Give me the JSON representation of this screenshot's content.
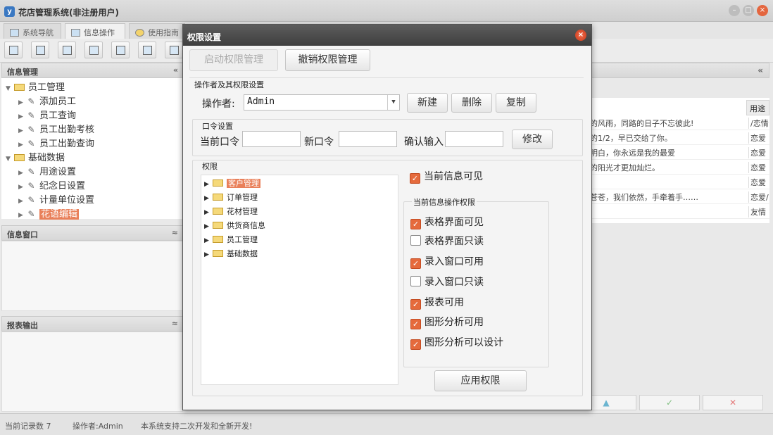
{
  "app": {
    "title": "花店管理系统(非注册用户)",
    "icon_glyph": "y"
  },
  "tabs": [
    {
      "label": "系统导航"
    },
    {
      "label": "信息操作"
    },
    {
      "label": "使用指南"
    }
  ],
  "left": {
    "panel1_title": "信息管理",
    "tree": [
      {
        "label": "员工管理",
        "type": "folder",
        "expanded": true
      },
      {
        "label": "添加员工",
        "type": "leaf"
      },
      {
        "label": "员工查询",
        "type": "leaf"
      },
      {
        "label": "员工出勤考核",
        "type": "leaf"
      },
      {
        "label": "员工出勤查询",
        "type": "leaf"
      },
      {
        "label": "基础数据",
        "type": "folder",
        "expanded": true
      },
      {
        "label": "用途设置",
        "type": "leaf"
      },
      {
        "label": "纪念日设置",
        "type": "leaf"
      },
      {
        "label": "计量单位设置",
        "type": "leaf"
      },
      {
        "label": "花语编辑",
        "type": "leaf",
        "selected": true
      }
    ],
    "panel2_title": "信息窗口",
    "panel3_title": "报表输出"
  },
  "right": {
    "column_header": "用途",
    "rows": [
      {
        "text": "的风雨，同路的日子不忘彼此!",
        "use": "/恋情"
      },
      {
        "text": "的1/2，早已交给了你。",
        "use": "恋爱"
      },
      {
        "text": "明白，你永远是我的最爱",
        "use": "恋爱"
      },
      {
        "text": "的阳光才更加灿烂。",
        "use": "恋爱"
      },
      {
        "text": "",
        "use": "恋爱"
      },
      {
        "text": "苍苍，我们依然，手牵着手……",
        "use": "恋爱/"
      },
      {
        "text": "",
        "use": "友情"
      }
    ],
    "nav_icons": [
      "up-icon",
      "check-icon",
      "cross-icon"
    ]
  },
  "status": {
    "record_count": "当前记录数 7",
    "operator": "操作者:Admin",
    "message": "本系统支持二次开发和全新开发!"
  },
  "dialog": {
    "title": "权限设置",
    "enable_btn": "启动权限管理",
    "revoke_btn": "撤销权限管理",
    "operator_group": "操作者及其权限设置",
    "operator_label": "操作者:",
    "operator_value": "Admin",
    "new_btn": "新建",
    "delete_btn": "删除",
    "copy_btn": "复制",
    "password_group": "口令设置",
    "current_pw_label": "当前口令",
    "new_pw_label": "新口令",
    "confirm_label": "确认输入",
    "modify_btn": "修改",
    "perm_group": "权限",
    "perm_tree": [
      {
        "label": "客户管理",
        "selected": true
      },
      {
        "label": "订单管理"
      },
      {
        "label": "花材管理"
      },
      {
        "label": "供货商信息"
      },
      {
        "label": "员工管理"
      },
      {
        "label": "基础数据"
      }
    ],
    "current_visible": {
      "label": "当前信息可见",
      "checked": true
    },
    "ops_group": "当前信息操作权限",
    "ops": [
      {
        "label": "表格界面可见",
        "checked": true
      },
      {
        "label": "表格界面只读",
        "checked": false
      },
      {
        "label": "录入窗口可用",
        "checked": true
      },
      {
        "label": "录入窗口只读",
        "checked": false
      },
      {
        "label": "报表可用",
        "checked": true
      },
      {
        "label": "图形分析可用",
        "checked": true
      },
      {
        "label": "图形分析可以设计",
        "checked": true
      }
    ],
    "apply_btn": "应用权限",
    "accent": "#e56a3c"
  }
}
